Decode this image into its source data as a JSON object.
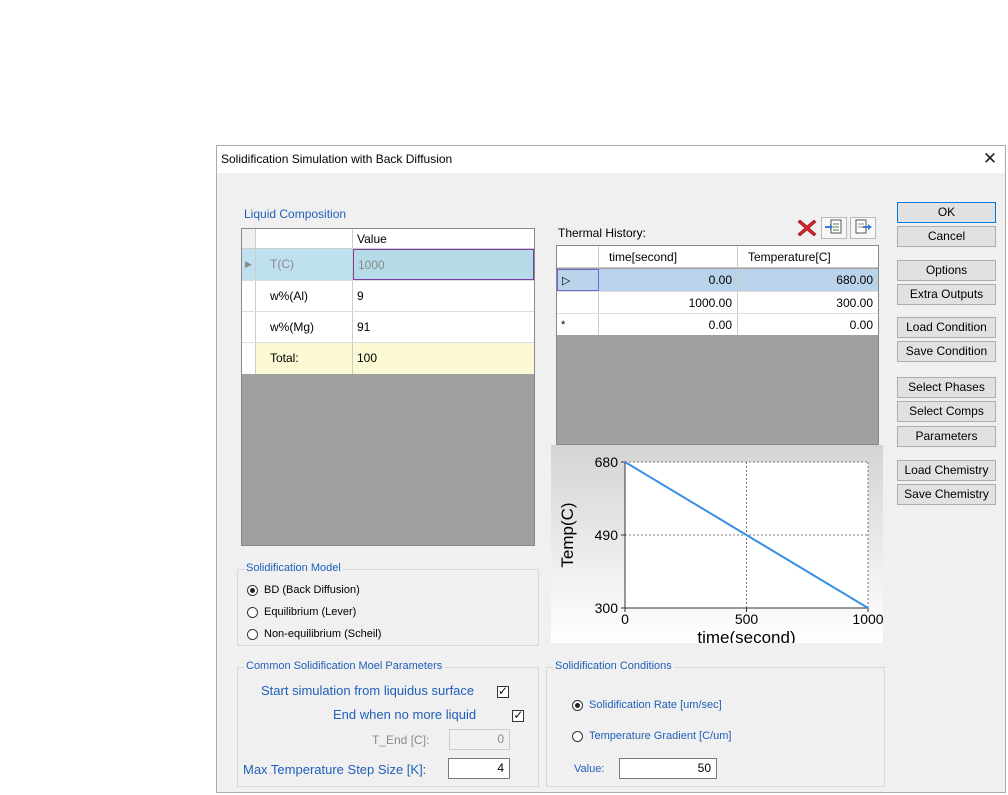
{
  "window": {
    "title": "Solidification Simulation with Back Diffusion",
    "close_glyph": "✕"
  },
  "liquid": {
    "label": "Liquid Composition",
    "header_value": "Value",
    "rows": [
      {
        "indicator": "▶",
        "name": "T(C)",
        "value": "1000"
      },
      {
        "indicator": "",
        "name": "w%(Al)",
        "value": "9"
      },
      {
        "indicator": "",
        "name": "w%(Mg)",
        "value": "91"
      },
      {
        "indicator": "",
        "name": "Total:",
        "value": "100"
      }
    ]
  },
  "model": {
    "label": "Solidification Model",
    "options": [
      "BD (Back Diffusion)",
      "Equilibrium (Lever)",
      "Non-equilibrium (Scheil)"
    ],
    "selected": "BD (Back Diffusion)"
  },
  "params": {
    "label": "Common Solidification Moel Parameters",
    "start_label": "Start simulation from liquidus surface",
    "start_checked": true,
    "end_label": "End when no more liquid",
    "end_checked": true,
    "tend_label": "T_End [C]:",
    "tend_value": "0",
    "maxstep_label": "Max Temperature Step Size [K]:",
    "maxstep_value": "4"
  },
  "thermal": {
    "label": "Thermal History:",
    "headers": [
      "time[second]",
      "Temperature[C]"
    ],
    "rows": [
      {
        "marker": "▷",
        "time": "0.00",
        "temp": "680.00"
      },
      {
        "marker": "",
        "time": "1000.00",
        "temp": "300.00"
      },
      {
        "marker": "*",
        "time": "0.00",
        "temp": "0.00"
      }
    ],
    "tools": [
      "delete-icon",
      "import-icon",
      "export-icon"
    ]
  },
  "chart_data": {
    "type": "line",
    "x": [
      0,
      1000
    ],
    "series": [
      {
        "values": [
          680,
          300
        ]
      }
    ],
    "xlabel": "time(second)",
    "ylabel": "Temp(C)",
    "xticks": [
      "0",
      "500",
      "1000"
    ],
    "yticks": [
      "680",
      "490",
      "300"
    ],
    "xlim": [
      0,
      1000
    ],
    "ylim": [
      300,
      680
    ],
    "grid": true,
    "line_color": "#3a8ee6"
  },
  "conditions": {
    "label": "Solidification Conditions",
    "options": [
      "Solidification Rate [um/sec]",
      "Temperature Gradient [C/um]"
    ],
    "selected": "Solidification Rate [um/sec]",
    "value_label": "Value:",
    "value": "50"
  },
  "buttons": {
    "ok": "OK",
    "cancel": "Cancel",
    "options": "Options",
    "extra_outputs": "Extra Outputs",
    "load_condition": "Load Condition",
    "save_condition": "Save Condition",
    "select_phases": "Select Phases",
    "select_comps": "Select Comps",
    "parameters": "Parameters",
    "load_chemistry": "Load Chemistry",
    "save_chemistry": "Save Chemistry"
  }
}
